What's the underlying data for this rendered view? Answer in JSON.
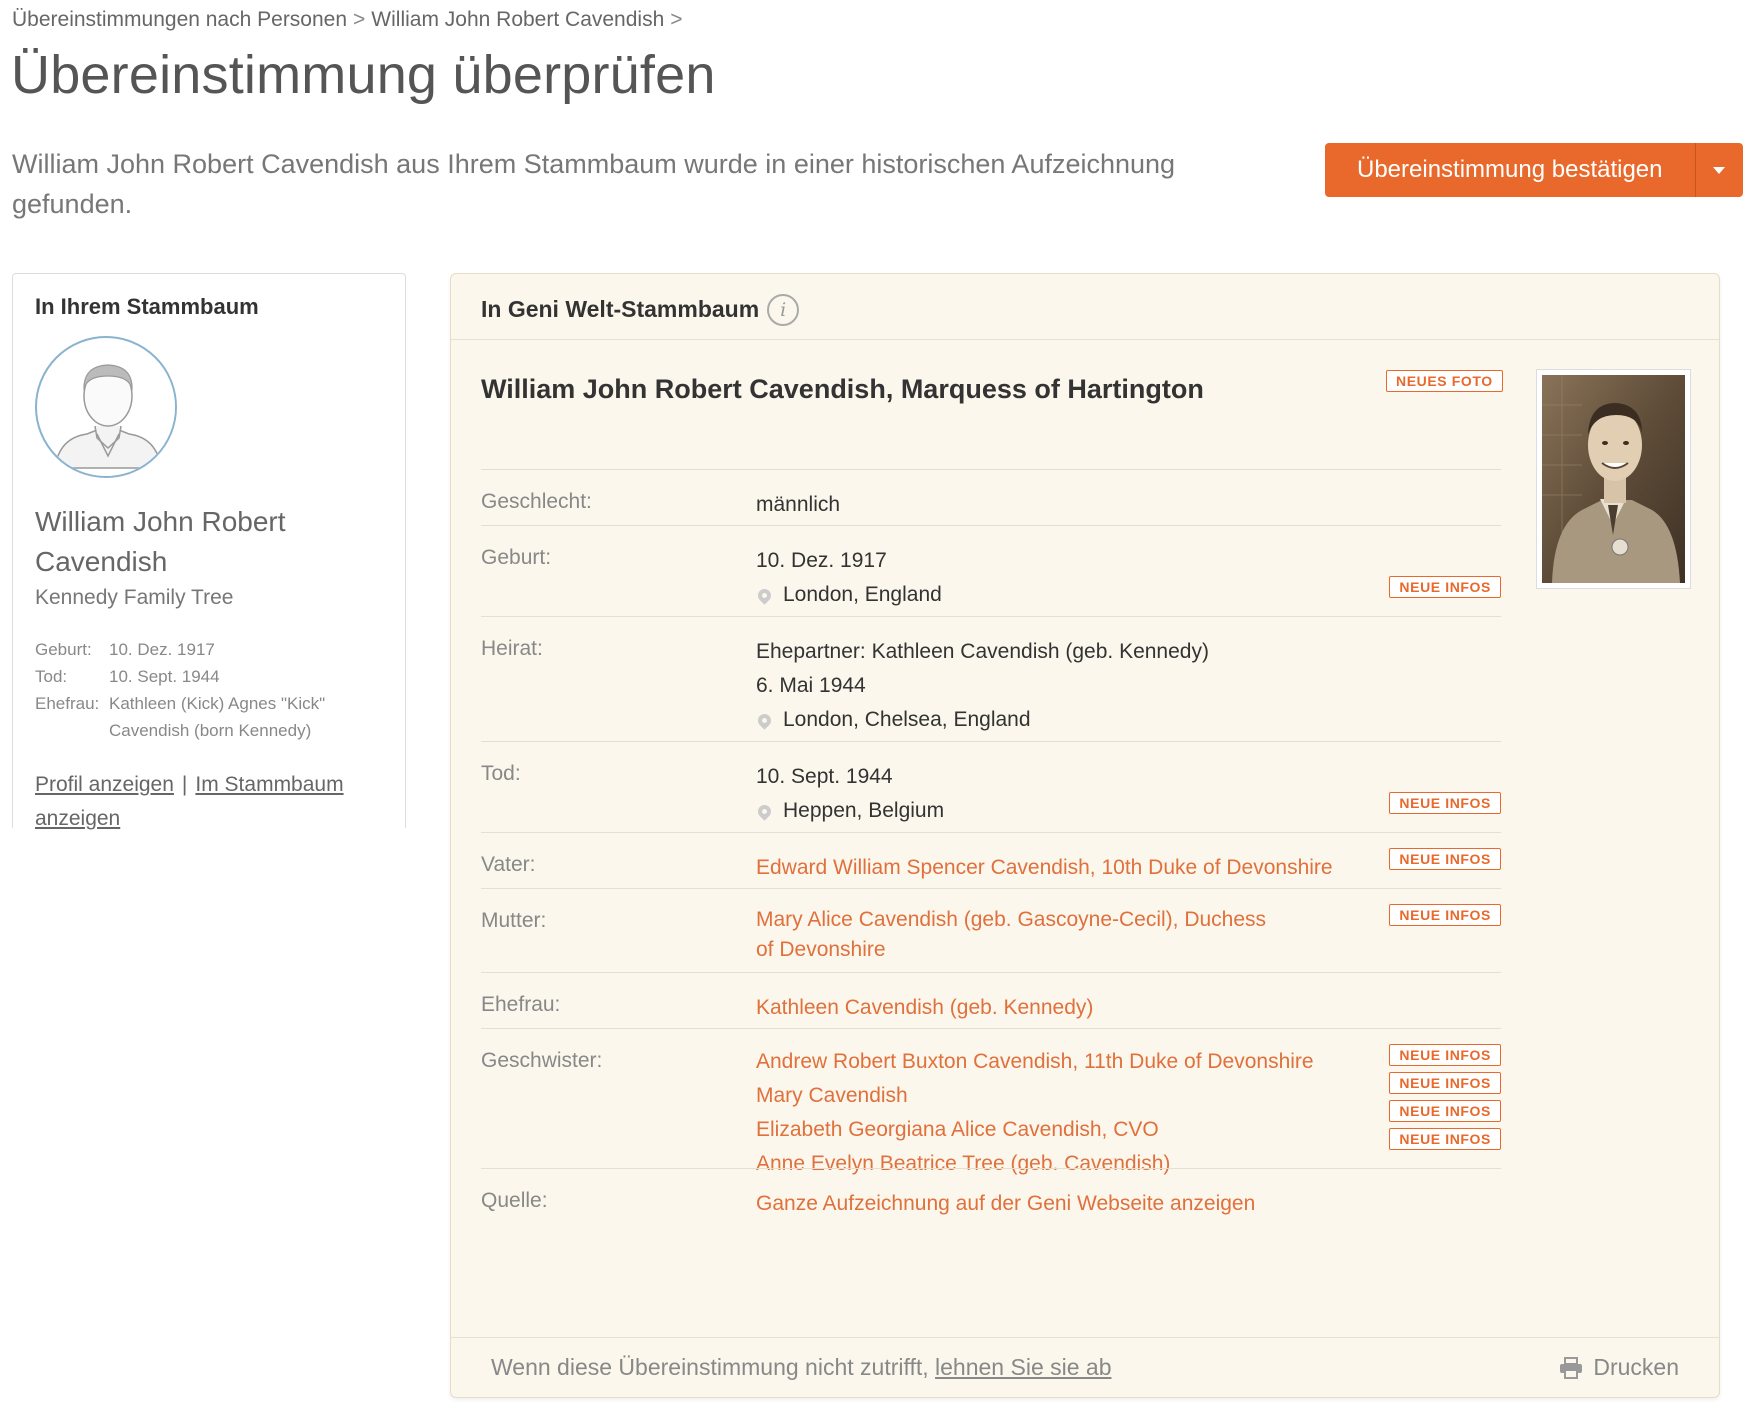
{
  "breadcrumb": {
    "items": [
      "Übereinstimmungen nach Personen",
      "William John Robert Cavendish"
    ],
    "separator": ">"
  },
  "page": {
    "title": "Übereinstimmung überprüfen",
    "intro": "William John Robert Cavendish aus Ihrem Stammbaum wurde in einer historischen Aufzeichnung gefunden."
  },
  "actions": {
    "confirm_label": "Übereinstimmung bestätigen",
    "accent_color": "#e8692b"
  },
  "left": {
    "title": "In Ihrem Stammbaum",
    "name": "William John Robert Cavendish",
    "tree": "Kennedy Family Tree",
    "facts": [
      {
        "label": "Geburt:",
        "value": "10. Dez. 1917"
      },
      {
        "label": "Tod:",
        "value": "10. Sept. 1944"
      },
      {
        "label": "Ehefrau:",
        "value": "Kathleen (Kick) Agnes \"Kick\" Cavendish (born Kennedy)"
      }
    ],
    "link_profile": "Profil anzeigen",
    "link_tree": "Im Stammbaum anzeigen",
    "link_separator": "|"
  },
  "right": {
    "title": "In Geni Welt-Stammbaum",
    "info_glyph": "i",
    "record_name": "William John Robert Cavendish, Marquess of Hartington",
    "badge_photo": "NEUES FOTO",
    "badge_info": "NEUE INFOS",
    "rows": {
      "gender": {
        "label": "Geschlecht:",
        "value": "männlich"
      },
      "birth": {
        "label": "Geburt:",
        "date": "10. Dez. 1917",
        "place": "London, England"
      },
      "marriage": {
        "label": "Heirat:",
        "spouse": "Ehepartner: Kathleen Cavendish (geb. Kennedy)",
        "date": "6. Mai 1944",
        "place": "London, Chelsea, England"
      },
      "death": {
        "label": "Tod:",
        "date": "10. Sept. 1944",
        "place": "Heppen, Belgium"
      },
      "father": {
        "label": "Vater:",
        "value": "Edward William Spencer Cavendish, 10th Duke of Devonshire"
      },
      "mother": {
        "label": "Mutter:",
        "value": "Mary Alice Cavendish (geb. Gascoyne-Cecil), Duchess of Devonshire"
      },
      "wife": {
        "label": "Ehefrau:",
        "value": "Kathleen Cavendish (geb. Kennedy)"
      },
      "siblings": {
        "label": "Geschwister:",
        "items": [
          "Andrew Robert Buxton Cavendish, 11th Duke of Devonshire",
          "Mary Cavendish",
          "Elizabeth Georgiana Alice Cavendish, CVO",
          "Anne Evelyn Beatrice Tree (geb. Cavendish)"
        ]
      },
      "source": {
        "label": "Quelle:",
        "value": "Ganze Aufzeichnung auf der Geni Webseite anzeigen"
      }
    },
    "footer": {
      "text": "Wenn diese Übereinstimmung nicht zutrifft,",
      "reject_link": "lehnen Sie sie ab",
      "print_label": "Drucken"
    }
  }
}
